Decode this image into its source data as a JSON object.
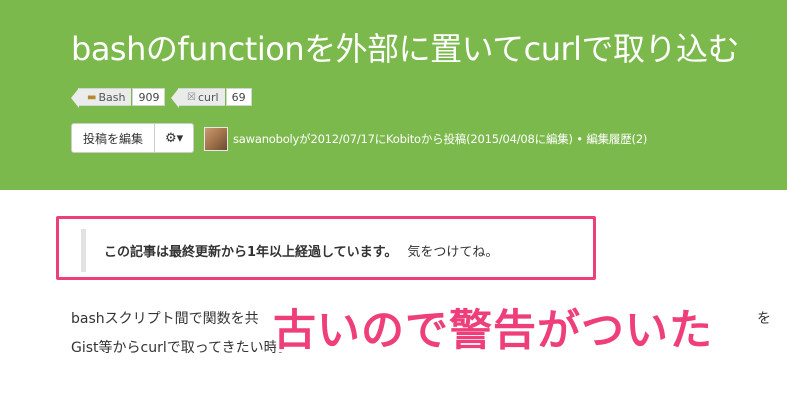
{
  "article": {
    "title": "bashのfunctionを外部に置いてcurlで取り込む"
  },
  "tags": [
    {
      "name": "Bash",
      "count": "909",
      "icon": "bash-tag-icon"
    },
    {
      "name": "curl",
      "count": "69",
      "icon": "curl-tag-icon"
    }
  ],
  "toolbar": {
    "edit_label": "投稿を編集",
    "gear_label": "⚙▾"
  },
  "meta": {
    "text": "sawanobolyが2012/07/17にKobitoから投稿(2015/04/08に編集) • 編集履歴(2)"
  },
  "warning": {
    "strong": "この記事は最終更新から1年以上経過しています。",
    "light": "気をつけてね。"
  },
  "body": {
    "line1": "bashスクリプト間で関数を共",
    "line1_end": "を",
    "line2": "Gist等からcurlで取ってきたい時。"
  },
  "annotation": {
    "text": "古いので警告がついた"
  },
  "colors": {
    "header_bg": "#7cb94c",
    "annotation": "#ee3f7a"
  }
}
